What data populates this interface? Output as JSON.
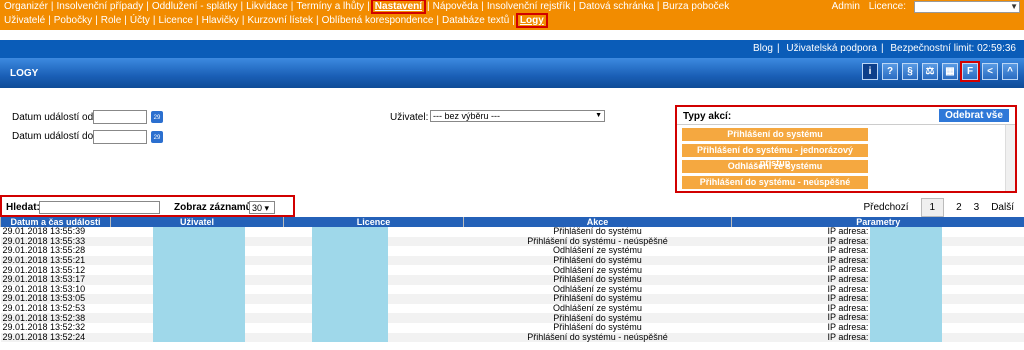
{
  "topnav": {
    "items": [
      "Organizér",
      "Insolvenční případy",
      "Oddlužení - splátky",
      "Likvidace",
      "Termíny a lhůty",
      "Nastavení",
      "Nápověda",
      "Insolvenční rejstřík",
      "Datová schránka",
      "Burza poboček"
    ],
    "active": "Nastavení",
    "admin_label": "Admin",
    "licence_label": "Licence:",
    "licence_value": ""
  },
  "subnav": {
    "items": [
      "Uživatelé",
      "Pobočky",
      "Role",
      "Účty",
      "Licence",
      "Hlavičky",
      "Kurzovní lístek",
      "Oblíbená korespondence",
      "Databáze textů",
      "Logy"
    ],
    "active": "Logy"
  },
  "bluebar": {
    "blog": "Blog",
    "support": "Uživatelská podpora",
    "limit": "Bezpečnostní limit: 02:59:36"
  },
  "title": "LOGY",
  "toolbar_icons": [
    "info-icon",
    "help-icon",
    "paragraph-icon",
    "law-icon",
    "calculator-icon",
    "f-icon",
    "back-icon",
    "up-icon"
  ],
  "toolbar_glyphs": [
    "i",
    "?",
    "§",
    "⚖",
    "▦",
    "F",
    "<",
    "^"
  ],
  "filters": {
    "from_label": "Datum událostí od:",
    "to_label": "Datum událostí do:",
    "from_value": "",
    "to_value": "",
    "user_label": "Uživatel:",
    "user_value": "--- bez výběru ---",
    "cal_glyph": "29"
  },
  "typy": {
    "label": "Typy akcí:",
    "remove_all": "Odebrat vše",
    "items": [
      "Přihlášení do systému",
      "Přihlášení do systému - jednorázový přístup",
      "Odhlášení ze systému",
      "Přihlášení do systému - neúspěšné"
    ]
  },
  "search": {
    "label": "Hledat:",
    "value": "",
    "count_label": "Zobraz záznamů:",
    "count_value": "30"
  },
  "pager": {
    "prev": "Předchozí",
    "pages": [
      "1",
      "2",
      "3"
    ],
    "current": "1",
    "next": "Další"
  },
  "table": {
    "headers": [
      "Datum a čas události",
      "Uživatel",
      "Licence",
      "Akce",
      "Parametry"
    ],
    "rows": [
      {
        "date": "29.01.2018 13:55:39",
        "action": "Přihlášení do systému",
        "params": "IP adresa:"
      },
      {
        "date": "29.01.2018 13:55:33",
        "action": "Přihlášení do systému - neúspěšné",
        "params": "IP adresa:"
      },
      {
        "date": "29.01.2018 13:55:28",
        "action": "Odhlášení ze systému",
        "params": "IP adresa:"
      },
      {
        "date": "29.01.2018 13:55:21",
        "action": "Přihlášení do systému",
        "params": "IP adresa:"
      },
      {
        "date": "29.01.2018 13:55:12",
        "action": "Odhlášení ze systému",
        "params": "IP adresa:"
      },
      {
        "date": "29.01.2018 13:53:17",
        "action": "Přihlášení do systému",
        "params": "IP adresa:"
      },
      {
        "date": "29.01.2018 13:53:10",
        "action": "Odhlášení ze systému",
        "params": "IP adresa:"
      },
      {
        "date": "29.01.2018 13:53:05",
        "action": "Přihlášení do systému",
        "params": "IP adresa:"
      },
      {
        "date": "29.01.2018 13:52:53",
        "action": "Odhlášení ze systému",
        "params": "IP adresa:"
      },
      {
        "date": "29.01.2018 13:52:38",
        "action": "Přihlášení do systému",
        "params": "IP adresa:"
      },
      {
        "date": "29.01.2018 13:52:32",
        "action": "Přihlášení do systému",
        "params": "IP adresa:"
      },
      {
        "date": "29.01.2018 13:52:24",
        "action": "Přihlášení do systému - neúspěšné",
        "params": "IP adresa:"
      }
    ]
  }
}
